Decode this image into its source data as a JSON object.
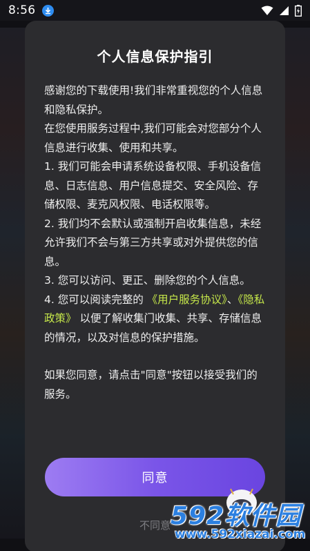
{
  "status_bar": {
    "time": "8:56",
    "icons": [
      "download-icon",
      "wifi-icon",
      "cellular-icon",
      "battery-charging-icon"
    ]
  },
  "dialog": {
    "title": "个人信息保护指引",
    "paragraphs": {
      "intro": "感谢您的下载使用!我们非常重视您的个人信息和隐私保护。",
      "usage": "在您使用服务过程中,我们可能会对您部分个人信息进行收集、使用和共享。",
      "item1": "1. 我们可能会申请系统设备权限、手机设备信息、日志信息、用户信息提交、安全风险、存储权限、麦克风权限、电话权限等。",
      "item2": "2. 我们均不会默认或强制开启收集信息，未经允许我们不会与第三方共享或对外提供您的信息。",
      "item3": "3. 您可以访问、更正、删除您的个人信息。",
      "item4_prefix": "4. 您可以阅读完整的",
      "user_agreement_link": "《用户服务协议》",
      "item4_sep": "、",
      "privacy_link": "《隐私政策》",
      "item4_suffix": "以便了解收集门收集、共享、存储信息的情况，以及对信息的保护措施。",
      "closing": "如果您同意，请点击\"同意\"按钮以接受我们的服务。"
    },
    "agree_label": "同意",
    "disagree_label": "不同意"
  },
  "watermark": {
    "logo_text": "592软件园",
    "url": "www.592xiazai.com"
  },
  "colors": {
    "dialog_bg": "#2c2c2f",
    "link": "#c6e84a",
    "button_start": "#9d7cf2",
    "button_end": "#6a45e0",
    "watermark": "#2b7fe0"
  }
}
